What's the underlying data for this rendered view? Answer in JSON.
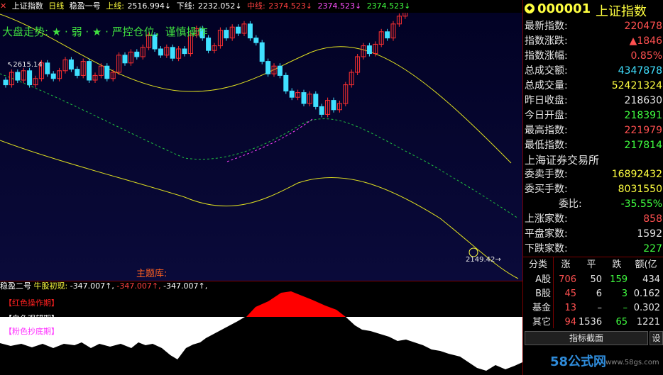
{
  "top_bar": {
    "name": "上证指数",
    "period": "日线",
    "indicator": "稳盈一号",
    "upper_label": "上线:",
    "upper_value": "2516.994↓",
    "lower_label": "下线:",
    "lower_value": "2232.052↓",
    "mid_label": "中线:",
    "mid_value": "2374.523↓",
    "mid_value2": "2374.523↓",
    "mid_value3": "2374.523↓"
  },
  "main_chart": {
    "status_text": "大盘走势: ★ · 弱 · ★ · 严控仓位，谨慎操作",
    "high_label": "2615.14",
    "low_label": "2149.42",
    "theme_label": "主题库:"
  },
  "sub_bar": {
    "indicator": "稳盈二号",
    "label": "牛股初现:",
    "v1": "-347.007↑,",
    "v2": "-347.007↑,",
    "v3": "-347.007↑,"
  },
  "sub_chart": {
    "legend_red": "【红色操作期】",
    "legend_white": "【白色观望期】",
    "legend_pink": "【粉色抄底期】"
  },
  "right_panel": {
    "code": "000001",
    "title": "上证指数",
    "rows": [
      {
        "label": "最新指数:",
        "value": "220478",
        "color": "#ff5050"
      },
      {
        "label": "指数涨跌:",
        "value": "▲1846",
        "color": "#ff5050"
      },
      {
        "label": "指数涨幅:",
        "value": "0.85%",
        "color": "#ff5050"
      },
      {
        "label": "总成交额:",
        "value": "4347878",
        "color": "#40e0ff"
      },
      {
        "label": "总成交量:",
        "value": "52421324",
        "color": "#ffff40"
      },
      {
        "label": "昨日收盘:",
        "value": "218630",
        "color": "#e6e6e6"
      },
      {
        "label": "今日开盘:",
        "value": "218391",
        "color": "#40ff40"
      },
      {
        "label": "最高指数:",
        "value": "221979",
        "color": "#ff5050"
      },
      {
        "label": "最低指数:",
        "value": "217814",
        "color": "#40ff40"
      }
    ],
    "exchange": "上海证券交易所",
    "rows2": [
      {
        "label": "委卖手数:",
        "value": "16892432",
        "color": "#ffff40"
      },
      {
        "label": "委买手数:",
        "value": "8031550",
        "color": "#ffff40"
      },
      {
        "label": "委比:",
        "value": "-35.55%",
        "color": "#40ff40"
      },
      {
        "label": "上涨家数:",
        "value": "858",
        "color": "#ff5050"
      },
      {
        "label": "平盘家数:",
        "value": "1592",
        "color": "#e6e6e6"
      },
      {
        "label": "下跌家数:",
        "value": "227",
        "color": "#40ff40"
      }
    ],
    "table_headers": [
      "分类",
      "涨",
      "平",
      "跌",
      "额(亿"
    ],
    "table_rows": [
      {
        "cat": "A股",
        "up": "706",
        "flat": "50",
        "down": "159",
        "amt": "434"
      },
      {
        "cat": "B股",
        "up": "45",
        "flat": "6",
        "down": "3",
        "amt": "0.162"
      },
      {
        "cat": "基金",
        "up": "13",
        "flat": "–",
        "down": "–",
        "amt": "0.302"
      },
      {
        "cat": "其它",
        "up": "94",
        "flat": "1536",
        "down": "65",
        "amt": "1221"
      }
    ],
    "button_label": "指标截面",
    "settings_label": "设",
    "watermark": "58公式网",
    "watermark_url": "www.58gs.com"
  }
}
